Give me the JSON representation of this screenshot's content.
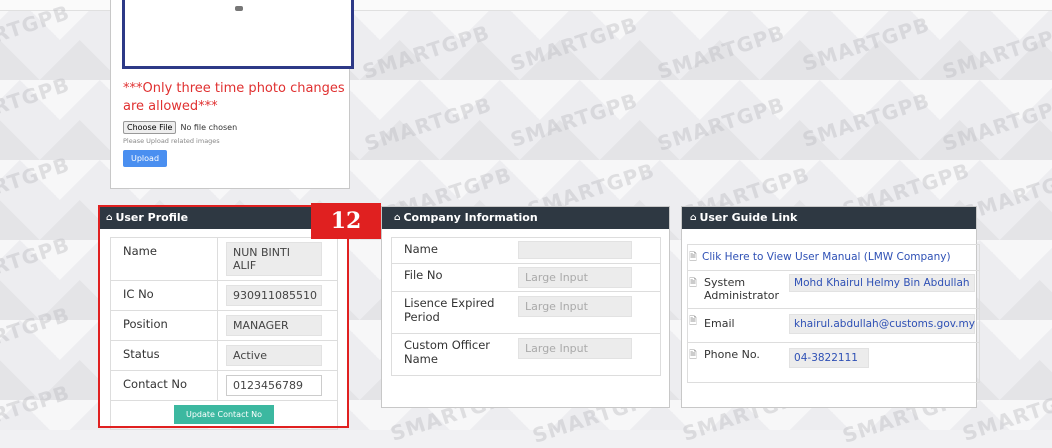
{
  "photo": {
    "warning": "***Only three time photo changes are allowed***",
    "choose_file": "Choose File",
    "no_file": "No file chosen",
    "hint": "Please Upload related images",
    "upload": "Upload"
  },
  "badge": "12",
  "watermark": "SMARTGPB",
  "user_profile": {
    "title": "User Profile",
    "rows": [
      {
        "label": "Name",
        "value": "NUN BINTI ALIF"
      },
      {
        "label": "IC No",
        "value": "930911085510"
      },
      {
        "label": "Position",
        "value": "MANAGER"
      },
      {
        "label": "Status",
        "value": "Active"
      },
      {
        "label": "Contact No",
        "value": "0123456789"
      }
    ],
    "update_button": "Update Contact No"
  },
  "company": {
    "title": "Company Information",
    "rows": [
      {
        "label": "Name",
        "placeholder": ""
      },
      {
        "label": "File No",
        "placeholder": "Large Input"
      },
      {
        "label": "Lisence Expired Period",
        "placeholder": "Large Input"
      },
      {
        "label": "Custom Officer Name",
        "placeholder": "Large Input"
      }
    ]
  },
  "user_guide": {
    "title": "User Guide Link",
    "manual_link": "Clik Here to View User Manual (LMW Company)",
    "rows": [
      {
        "label": "System Administrator",
        "value": "Mohd Khairul Helmy Bin Abdullah"
      },
      {
        "label": "Email",
        "value": "khairul.abdullah@customs.gov.my"
      },
      {
        "label": "Phone No.",
        "value": "04-3822111"
      }
    ]
  },
  "colors": {
    "header_bg": "#2e3842",
    "accent_red": "#e02020",
    "teal_button": "#3cb8a0",
    "upload_blue": "#4a8ff0"
  }
}
